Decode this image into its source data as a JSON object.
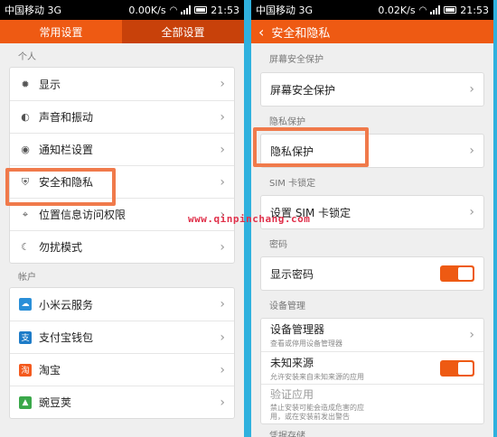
{
  "status": {
    "carrier": "中国移动 3G",
    "left_speed": "0.00K/s",
    "right_speed": "0.02K/s",
    "time": "21:53"
  },
  "left": {
    "tabs": [
      "常用设置",
      "全部设置"
    ],
    "section_personal": "个人",
    "personal_items": [
      {
        "label": "显示",
        "icon": "gear-icon"
      },
      {
        "label": "声音和振动",
        "icon": "speaker-icon"
      },
      {
        "label": "通知栏设置",
        "icon": "toggle-icon"
      },
      {
        "label": "安全和隐私",
        "icon": "shield-icon"
      },
      {
        "label": "位置信息访问权限",
        "icon": "location-icon"
      },
      {
        "label": "勿扰模式",
        "icon": "moon-icon"
      }
    ],
    "section_account": "帐户",
    "account_items": [
      {
        "label": "小米云服务",
        "icon": "cloud-icon"
      },
      {
        "label": "支付宝钱包",
        "icon": "alipay-icon"
      },
      {
        "label": "淘宝",
        "icon": "taobao-icon"
      },
      {
        "label": "豌豆荚",
        "icon": "wandoujia-icon"
      }
    ]
  },
  "right": {
    "title": "安全和隐私",
    "sections": {
      "screen": "屏幕安全保护",
      "privacy": "隐私保护",
      "sim": "SIM 卡锁定",
      "password": "密码",
      "device": "设备管理",
      "storage": "凭据存储"
    },
    "screen_item": "屏幕安全保护",
    "privacy_item": "隐私保护",
    "sim_item": "设置 SIM 卡锁定",
    "show_password": "显示密码",
    "device_admin": "设备管理器",
    "device_admin_sub": "查看或停用设备管理器",
    "unknown_sources": "未知来源",
    "unknown_sources_sub": "允许安装来自未知来源的应用",
    "verify_apps": "验证应用",
    "verify_apps_sub": "禁止安装可能会造成危害的应用，或在安装前发出警告"
  },
  "watermark": "www.qinpinchang.com",
  "colors": {
    "accent": "#ee5a13",
    "highlight": "#f07a4b",
    "background": "#2fb1de"
  }
}
